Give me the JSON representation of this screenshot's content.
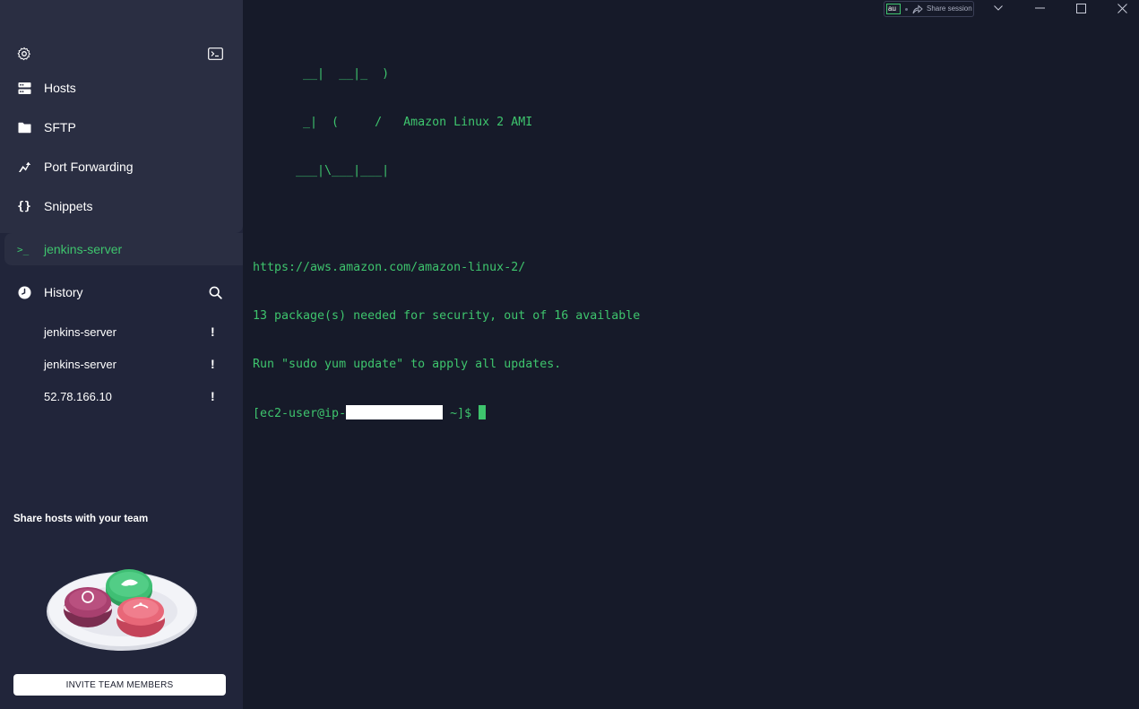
{
  "sidebar": {
    "nav": [
      {
        "label": "Hosts",
        "icon": "hosts-icon"
      },
      {
        "label": "SFTP",
        "icon": "folder-icon"
      },
      {
        "label": "Port Forwarding",
        "icon": "port-forwarding-icon"
      },
      {
        "label": "Snippets",
        "icon": "snippets-icon"
      }
    ],
    "active_session": {
      "label": "jenkins-server",
      "icon_text": ">_"
    },
    "history": {
      "title": "History",
      "items": [
        {
          "label": "jenkins-server",
          "status": "!"
        },
        {
          "label": "jenkins-server",
          "status": "!"
        },
        {
          "label": "52.78.166.10",
          "status": "!"
        }
      ]
    },
    "promo": {
      "title": "Share hosts with your team",
      "button_label": "INVITE TEAM MEMBERS"
    }
  },
  "titlebar": {
    "input_value": "au",
    "share_label": "Share session"
  },
  "terminal": {
    "lines": [
      "       __|  __|_  )",
      "       _|  (     /   Amazon Linux 2 AMI",
      "      ___|\\___|___|",
      "",
      "https://aws.amazon.com/amazon-linux-2/",
      "13 package(s) needed for security, out of 16 available",
      "Run \"sudo yum update\" to apply all updates."
    ],
    "prompt_prefix": "[ec2-user@ip-",
    "prompt_suffix": " ~]$ "
  },
  "colors": {
    "accent": "#3ec46d",
    "background": "#161a29",
    "sidebar": "#21253a",
    "panel": "#2a2e42"
  }
}
